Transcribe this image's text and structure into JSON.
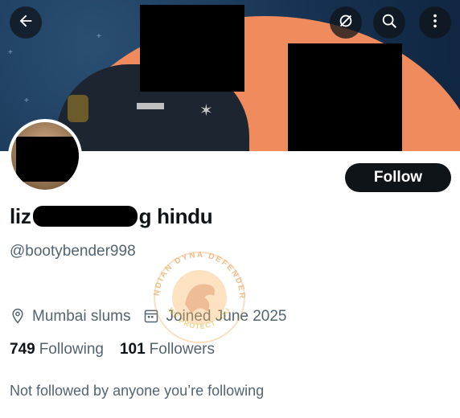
{
  "header": {
    "back_icon": "arrow-left-icon",
    "hide_icon": "eye-slash-icon",
    "search_icon": "search-icon",
    "more_icon": "more-vertical-icon"
  },
  "profile": {
    "display_name_start": "liz",
    "display_name_end": "g hindu",
    "handle": "@bootybender998",
    "location": "Mumbai slums",
    "joined": "Joined June 2025",
    "following_count": "749",
    "following_label": "Following",
    "followers_count": "101",
    "followers_label": "Followers",
    "not_followed_text": "Not followed by anyone you’re following"
  },
  "actions": {
    "follow_label": "Follow"
  },
  "watermark": {
    "text_top": "INDIAN DYNA DEFENDER",
    "text_bottom": "WE PROTECT YOU"
  },
  "colors": {
    "banner_bg": "#173352",
    "banner_orange": "#f08b5e",
    "text_primary": "#0f1419",
    "text_secondary": "#536471",
    "button_bg": "#0f1419"
  }
}
